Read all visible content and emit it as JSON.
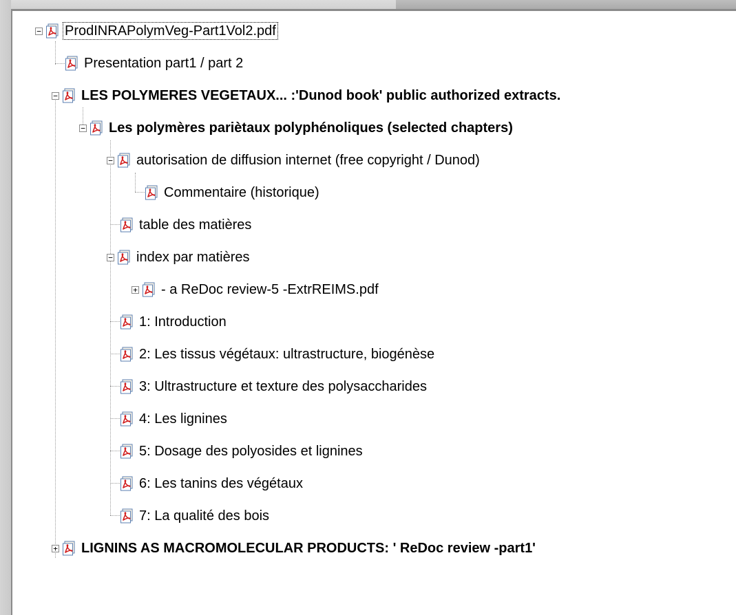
{
  "tree": {
    "items": [
      {
        "label": "ProdINRAPolymVeg-Part1Vol2.pdf",
        "icon": "pdf-icon",
        "level": 0,
        "expanded": true,
        "bold": false
      },
      {
        "label": "Presentation part1 / part 2",
        "icon": "pdf-icon",
        "level": 1,
        "bold": false
      },
      {
        "label": "LES POLYMERES VEGETAUX... :'Dunod book' public authorized extracts.",
        "icon": "pdf-icon",
        "level": 1,
        "expanded": true,
        "bold": true
      },
      {
        "label": "Les polymères pariètaux polyphénoliques (selected chapters)",
        "icon": "pdf-icon",
        "level": 2,
        "expanded": true,
        "bold": true
      },
      {
        "label": "autorisation de diffusion internet (free copyright / Dunod)",
        "icon": "pdf-icon",
        "level": 3,
        "expanded": true,
        "bold": false
      },
      {
        "label": "Commentaire (historique)",
        "icon": "pdf-icon",
        "level": 4,
        "bold": false
      },
      {
        "label": "table des matières",
        "icon": "pdf-icon",
        "level": 3,
        "bold": false
      },
      {
        "label": "index par matières",
        "icon": "pdf-icon",
        "level": 3,
        "expanded": true,
        "bold": false
      },
      {
        "label": "- a ReDoc review-5 -ExtrREIMS.pdf",
        "icon": "pdf-icon",
        "level": 4,
        "expanded": false,
        "bold": false
      },
      {
        "label": "1: Introduction",
        "icon": "pdf-icon",
        "level": 3,
        "bold": false
      },
      {
        "label": "2: Les tissus végétaux: ultrastructure, biogénèse",
        "icon": "pdf-icon",
        "level": 3,
        "bold": false
      },
      {
        "label": "3: Ultrastructure et texture des polysaccharides",
        "icon": "pdf-icon",
        "level": 3,
        "bold": false
      },
      {
        "label": "4: Les lignines",
        "icon": "pdf-icon",
        "level": 3,
        "bold": false
      },
      {
        "label": "5: Dosage des polyosides et lignines",
        "icon": "pdf-icon",
        "level": 3,
        "bold": false
      },
      {
        "label": "6: Les tanins des végétaux",
        "icon": "pdf-icon",
        "level": 3,
        "bold": false
      },
      {
        "label": "7: La qualité des bois",
        "icon": "pdf-icon",
        "level": 3,
        "bold": false
      },
      {
        "label": "LIGNINS AS MACROMOLECULAR PRODUCTS: ' ReDoc review -part1'",
        "icon": "pdf-icon",
        "level": 1,
        "expanded": false,
        "bold": true
      }
    ]
  },
  "colors": {
    "pdf_red": "#d21f1f",
    "pdf_page": "#fdf6e8",
    "pdf_border": "#5b7fb0"
  }
}
